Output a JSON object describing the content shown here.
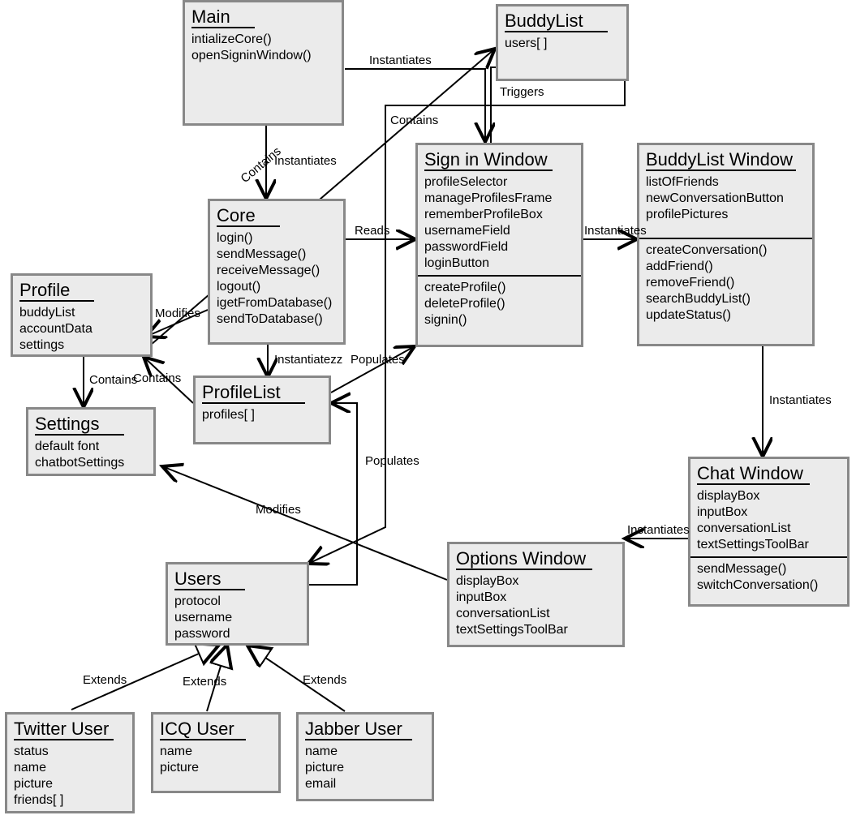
{
  "classes": {
    "main": {
      "title": "Main",
      "attrs": [],
      "ops": [
        "intializeCore()",
        "openSigninWindow()"
      ]
    },
    "buddylist": {
      "title": "BuddyList",
      "attrs": [
        "users[ ]"
      ],
      "ops": []
    },
    "core": {
      "title": "Core",
      "attrs": [],
      "ops": [
        "login()",
        "sendMessage()",
        "receiveMessage()",
        "logout()",
        "igetFromDatabase()",
        "sendToDatabase()"
      ]
    },
    "signin": {
      "title": "Sign in Window",
      "attrs": [
        "profileSelector",
        "manageProfilesFrame",
        "rememberProfileBox",
        "usernameField",
        "passwordField",
        "loginButton"
      ],
      "ops": [
        "createProfile()",
        "deleteProfile()",
        "signin()"
      ]
    },
    "blwindow": {
      "title": "BuddyList Window",
      "attrs": [
        "listOfFriends",
        "newConversationButton",
        "profilePictures"
      ],
      "ops": [
        "createConversation()",
        "addFriend()",
        "removeFriend()",
        "searchBuddyList()",
        "updateStatus()"
      ]
    },
    "profile": {
      "title": "Profile",
      "attrs": [
        "buddyList",
        "accountData",
        "settings"
      ],
      "ops": []
    },
    "profilelist": {
      "title": "ProfileList",
      "attrs": [
        "profiles[ ]"
      ],
      "ops": []
    },
    "settings": {
      "title": "Settings",
      "attrs": [
        "default font",
        "chatbotSettings"
      ],
      "ops": []
    },
    "users": {
      "title": "Users",
      "attrs": [
        "protocol",
        "username",
        "password"
      ],
      "ops": []
    },
    "options": {
      "title": "Options Window",
      "attrs": [
        "displayBox",
        "inputBox",
        "conversationList",
        "textSettingsToolBar"
      ],
      "ops": []
    },
    "chat": {
      "title": "Chat Window",
      "attrs": [
        "displayBox",
        "inputBox",
        "conversationList",
        "textSettingsToolBar"
      ],
      "ops": [
        "sendMessage()",
        "switchConversation()"
      ]
    },
    "twitter": {
      "title": "Twitter User",
      "attrs": [
        "status",
        "name",
        "picture",
        "friends[ ]"
      ],
      "ops": []
    },
    "icq": {
      "title": "ICQ User",
      "attrs": [
        "name",
        "picture"
      ],
      "ops": []
    },
    "jabber": {
      "title": "Jabber User",
      "attrs": [
        "name",
        "picture",
        "email"
      ],
      "ops": []
    }
  },
  "relations": {
    "main_signin": "Instantiates",
    "signin_buddylist": "Triggers",
    "main_core": "Instantiates",
    "core_signin": "Reads",
    "signin_blwindow": "Instantiates",
    "core_profile": "Modifies",
    "core_profilelist": "Instantiatezz",
    "profilelist_profile": "Contains",
    "profilelist_signin": "Populates",
    "profile_settings": "Contains",
    "options_settings": "Modifies",
    "blwindow_chat": "Instantiates",
    "chat_options": "Instantiates",
    "users_profilelist": "Populates",
    "profile_buddylist": "Contains",
    "buddylist_users": "Contains",
    "twitter_users": "Extends",
    "icq_users": "Extends",
    "jabber_users": "Extends"
  }
}
